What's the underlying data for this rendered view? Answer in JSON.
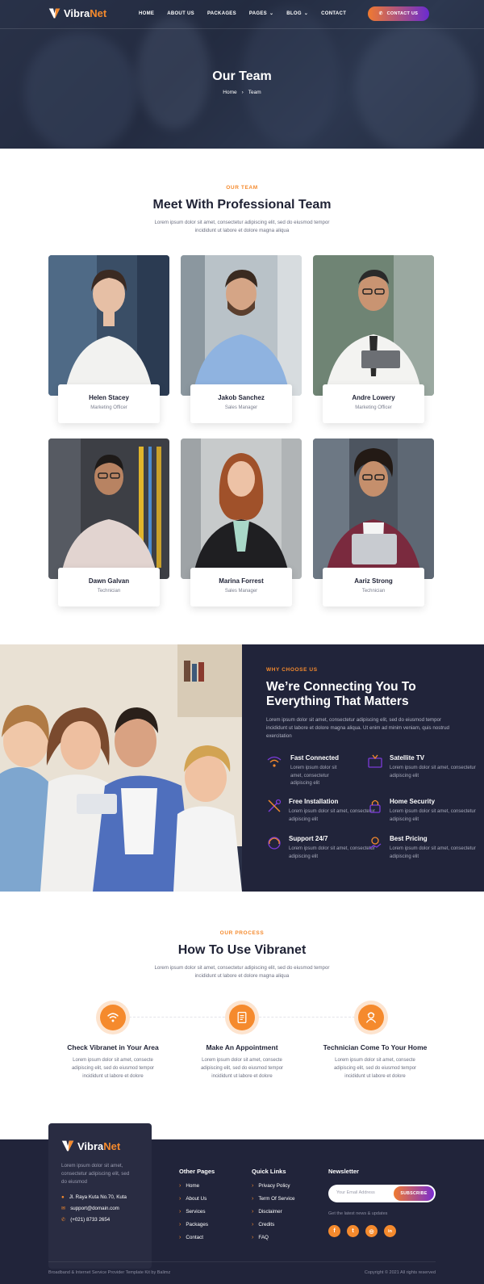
{
  "nav": {
    "logo": "VibraNet",
    "logo_part1": "Vibra",
    "logo_part2": "Net",
    "items": [
      "HOME",
      "ABOUT US",
      "PACKAGES",
      "PAGES",
      "BLOG",
      "CONTACT"
    ],
    "contact_button": "CONTACT US"
  },
  "hero": {
    "title": "Our Team",
    "breadcrumb_home": "Home",
    "breadcrumb_current": "Team"
  },
  "team": {
    "eyebrow": "OUR TEAM",
    "title": "Meet With Professional Team",
    "subtitle": "Lorem ipsum dolor sit amet, consectetur adipiscing elit, sed do eiusmod tempor incididunt ut labore et dolore magna aliqua",
    "members": [
      {
        "name": "Helen Stacey",
        "role": "Marketing Officer"
      },
      {
        "name": "Jakob Sanchez",
        "role": "Sales Manager"
      },
      {
        "name": "Andre Lowery",
        "role": "Marketing Officer"
      },
      {
        "name": "Dawn Galvan",
        "role": "Technician"
      },
      {
        "name": "Marina Forrest",
        "role": "Sales Manager"
      },
      {
        "name": "Aariz Strong",
        "role": "Technician"
      }
    ]
  },
  "why": {
    "eyebrow": "WHY CHOOSE US",
    "title_line1": "We’re Connecting You To",
    "title_line2": "Everything That Matters",
    "text": "Lorem ipsum dolor sit amet, consectetur adipiscing elit, sed do eiusmod tempor incididunt ut labore et dolore magna aliqua. Ut enim ad minim veniam, quis nostrud exercitation",
    "features": [
      {
        "title": "Fast Connected",
        "desc": "Lorem ipsum dolor sit amet, consectetur adipiscing elit",
        "icon": "wifi-icon"
      },
      {
        "title": "Satellite TV",
        "desc": "Lorem ipsum dolor sit amet, consectetur adipiscing elit",
        "icon": "tv-icon"
      },
      {
        "title": "Free Installation",
        "desc": "Lorem ipsum dolor sit amet, consectetur adipiscing elit",
        "icon": "tools-icon"
      },
      {
        "title": "Home Security",
        "desc": "Lorem ipsum dolor sit amet, consectetur adipiscing elit",
        "icon": "lock-icon"
      },
      {
        "title": "Support 24/7",
        "desc": "Lorem ipsum dolor sit amet, consectetur adipiscing elit",
        "icon": "support-icon"
      },
      {
        "title": "Best Pricing",
        "desc": "Lorem ipsum dolor sit amet, consectetur adipiscing elit",
        "icon": "pricing-icon"
      }
    ]
  },
  "process": {
    "eyebrow": "OUR PROCESS",
    "title": "How To Use Vibranet",
    "subtitle": "Lorem ipsum dolor sit amet, consectetur adipiscing elit, sed do eiusmod tempor incididunt ut labore et dolore magna aliqua",
    "steps": [
      {
        "title": "Check Vibranet in Your Area",
        "desc": "Lorem ipsum dolor sit amet, consecte adipiscing elit, sed do eiusmod tempor incididunt ut labore et dolore",
        "icon": "wifi-icon"
      },
      {
        "title": "Make An Appointment",
        "desc": "Lorem ipsum dolor sit amet, consecte adipiscing elit, sed do eiusmod tempor incididunt ut labore et dolore",
        "icon": "appointment-icon"
      },
      {
        "title": "Technician Come To Your Home",
        "desc": "Lorem ipsum dolor sit amet, consecte adipiscing elit, sed do eiusmod tempor incididunt ut labore et dolore",
        "icon": "technician-icon"
      }
    ]
  },
  "footer": {
    "about": "Lorem ipsum dolor sit amet, consectetur adipiscing elit, sed do eiusmod",
    "address": "Jl. Raya Kuta No.70, Kuta",
    "email": "support@domain.com",
    "phone": "(+021) 8733 2654",
    "other_pages_title": "Other Pages",
    "other_pages": [
      "Home",
      "About Us",
      "Services",
      "Packages",
      "Contact"
    ],
    "quick_links_title": "Quick Links",
    "quick_links": [
      "Privacy Policy",
      "Term Of Service",
      "Disclaimer",
      "Credits",
      "FAQ"
    ],
    "newsletter_title": "Newsletter",
    "newsletter_placeholder": "Your Email Address",
    "newsletter_button": "SUBSCRIBE",
    "newsletter_note": "Get the latest news & updates",
    "socials": [
      "f",
      "t",
      "◎",
      "in"
    ],
    "credit": "Broadband & Internet Service Provider Template Kit by Balimz",
    "copyright": "Copyright © 2021 All rights reserved"
  },
  "colors": {
    "accent": "#f58a2d",
    "dark": "#21243a",
    "purple": "#6a2bd0"
  }
}
